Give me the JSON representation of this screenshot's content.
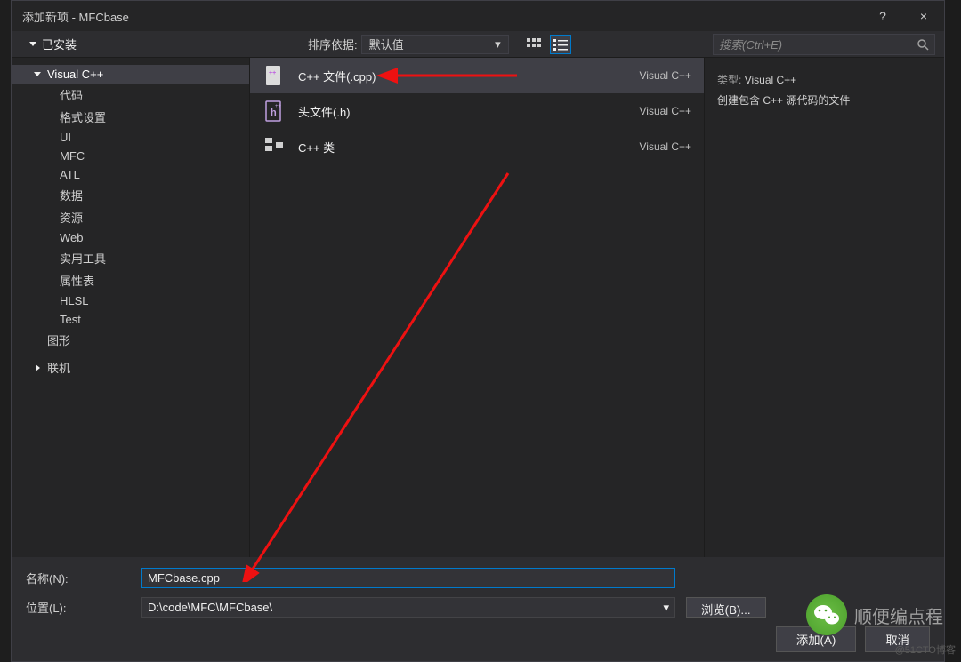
{
  "window": {
    "title": "添加新项 - MFCbase",
    "help": "?",
    "close": "×"
  },
  "toolbar": {
    "installed_label": "已安装",
    "sort_label": "排序依据:",
    "sort_value": "默认值",
    "search_placeholder": "搜索(Ctrl+E)"
  },
  "sidebar": {
    "root": "Visual C++",
    "items": [
      "代码",
      "格式设置",
      "UI",
      "MFC",
      "ATL",
      "数据",
      "资源",
      "Web",
      "实用工具",
      "属性表",
      "HLSL",
      "Test"
    ],
    "graphics": "图形",
    "online": "联机"
  },
  "templates": [
    {
      "name": "C++ 文件(.cpp)",
      "lang": "Visual C++",
      "icon": "cpp-file-icon"
    },
    {
      "name": "头文件(.h)",
      "lang": "Visual C++",
      "icon": "header-file-icon"
    },
    {
      "name": "C++ 类",
      "lang": "Visual C++",
      "icon": "cpp-class-icon"
    }
  ],
  "detail": {
    "type_label": "类型:",
    "type_value": "Visual C++",
    "description": "创建包含 C++ 源代码的文件"
  },
  "bottom": {
    "name_label": "名称(N):",
    "name_value": "MFCbase.cpp",
    "location_label": "位置(L):",
    "location_value": "D:\\code\\MFC\\MFCbase\\",
    "browse_label": "浏览(B)...",
    "add_label": "添加(A)",
    "cancel_label": "取消"
  },
  "overlay": {
    "brand": "顺便编点程",
    "watermark": "@51CTO博客"
  }
}
